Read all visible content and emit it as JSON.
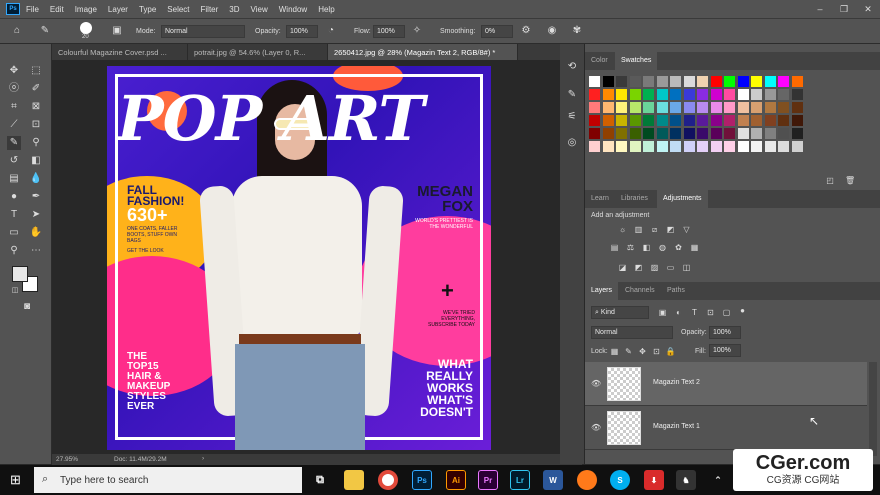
{
  "menu": {
    "app_icon": "Ps",
    "items": [
      "File",
      "Edit",
      "Image",
      "Layer",
      "Type",
      "Select",
      "Filter",
      "3D",
      "View",
      "Window",
      "Help"
    ]
  },
  "options": {
    "brush_size": "20",
    "mode_label": "Mode:",
    "mode_value": "Normal",
    "opacity_label": "Opacity:",
    "opacity_value": "100%",
    "flow_label": "Flow:",
    "flow_value": "100%",
    "smoothing_label": "Smoothing:",
    "smoothing_value": "0%"
  },
  "tabs": [
    {
      "label": "Colourful Magazine Cover.psd ..."
    },
    {
      "label": "potrait.jpg @ 54.6% (Layer 0, R..."
    },
    {
      "label": "2650412.jpg @ 28% (Magazin Text 2, RGB/8#) *"
    }
  ],
  "cover": {
    "title": "POP ART",
    "fall": "FALL",
    "fashion": "FASHION!",
    "count": "630+",
    "blurb1": "ONE COATS, FALLER BOOTS, STUFF OWN BAGS",
    "blurb2": "GET THE LOOK",
    "name_line1": "MEGAN",
    "name_line2": "FOX",
    "name_sub": "WORLD'S PRETTIEST IS THE WONDERFUL",
    "plus": "+",
    "top_line1": "THE",
    "top_line2": "TOP15",
    "top_line3": "HAIR &",
    "top_line4": "MAKEUP",
    "top_line5": "STYLES",
    "top_line6": "EVER",
    "right_sub": "WE'VE TRIED EVERYTHING, SUBSCRIBE TODAY",
    "what_line1": "WHAT",
    "what_line2": "REALLY",
    "what_line3": "WORKS",
    "what_line4": "WHAT'S",
    "what_line5": "DOESN'T"
  },
  "status": {
    "zoom": "27.95%",
    "doc": "Doc: 11.4M/29.2M"
  },
  "color_panel": {
    "tabs": [
      "Color",
      "Swatches"
    ],
    "active": "Swatches"
  },
  "adjust_panel": {
    "tabs": [
      "Learn",
      "Libraries",
      "Adjustments"
    ],
    "hint": "Add an adjustment"
  },
  "layers_panel": {
    "tabs": [
      "Layers",
      "Channels",
      "Paths"
    ],
    "kind_label": "Kind",
    "blend_mode": "Normal",
    "opacity_label": "Opacity:",
    "opacity_value": "100%",
    "lock_label": "Lock:",
    "fill_label": "Fill:",
    "fill_value": "100%",
    "layers": [
      {
        "name": "Magazin Text 2"
      },
      {
        "name": "Magazin Text 1"
      }
    ]
  },
  "taskbar": {
    "search_placeholder": "Type here to search",
    "apps": [
      "Ps",
      "Ai",
      "Pr",
      "Lr",
      "W"
    ]
  },
  "watermark": {
    "line1": "CGer.com",
    "line2": "CG资源 CG网站"
  }
}
